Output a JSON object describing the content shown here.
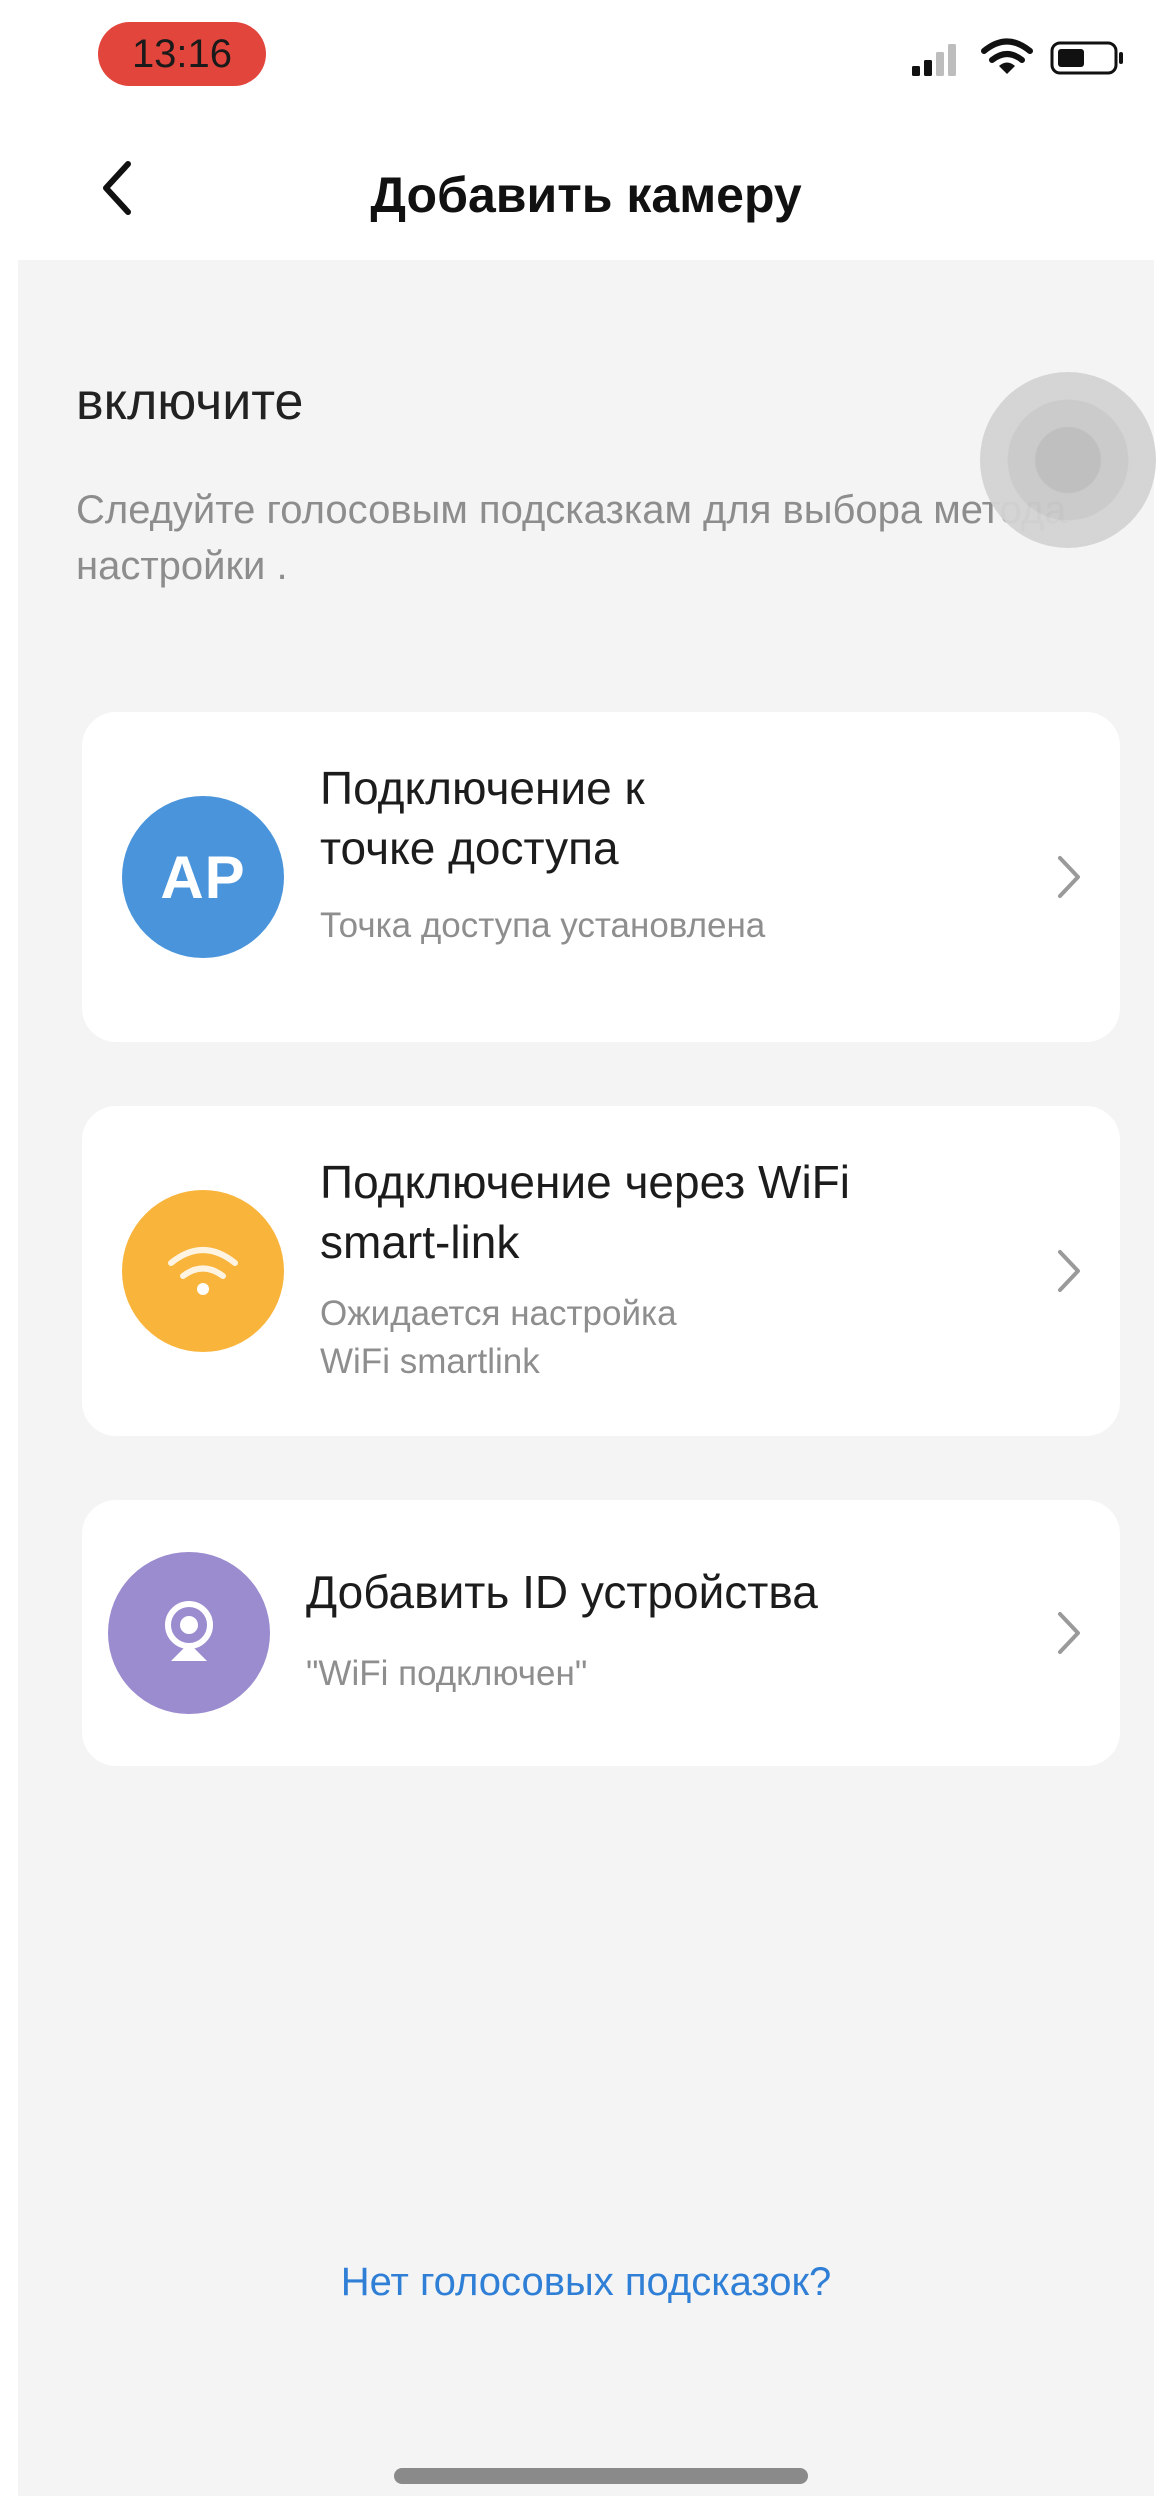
{
  "status_bar": {
    "time": "13:16",
    "signal_icon": "cellular-signal-icon",
    "wifi_icon": "wifi-icon",
    "battery_icon": "battery-icon"
  },
  "nav": {
    "back_icon": "chevron-left-icon",
    "title": "Добавить камеру"
  },
  "intro": {
    "headline": "включите",
    "description": "Следуйте голосовым подсказкам для выбора метода настройки ."
  },
  "options": [
    {
      "icon": "ap-icon",
      "icon_text": "AP",
      "icon_color": "#4a94db",
      "title": "Подключение к\nточке доступа",
      "subtitle": "Точка доступа установлена"
    },
    {
      "icon": "wifi-icon",
      "icon_color": "#f9b43b",
      "title": "Подключение через WiFi\nsmart-link",
      "subtitle": "Ожидается настройка\nWiFi smartlink"
    },
    {
      "icon": "camera-id-icon",
      "icon_color": "#9b8bcf",
      "title": "Добавить ID устройства",
      "subtitle": "\"WiFi подключен\""
    }
  ],
  "help_link": "Нет голосовых подсказок?",
  "colors": {
    "accent_link": "#2f7fd6",
    "time_pill": "#e2453b",
    "background": "#f4f4f4"
  }
}
